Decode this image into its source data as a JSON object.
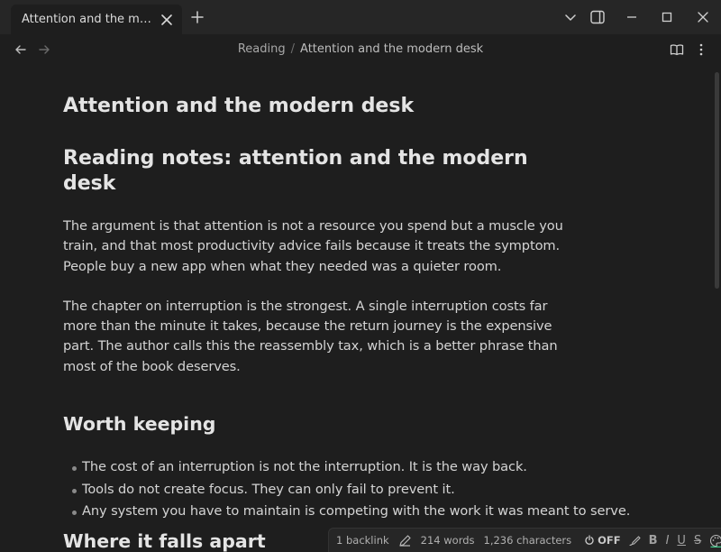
{
  "tab": {
    "title": "Attention and the modern desk"
  },
  "breadcrumb": {
    "folder": "Reading",
    "separator": "/",
    "current": "Attention and the modern desk"
  },
  "note": {
    "title": "Attention and the modern desk",
    "heading": "Reading notes: attention and the modern desk",
    "paragraphs": [
      "The argument is that attention is not a resource you spend but a muscle you train, and that most productivity advice fails because it treats the symptom. People buy a new app when what they needed was a quieter room.",
      "The chapter on interruption is the strongest. A single interruption costs far more than the minute it takes, because the return journey is the expensive part. The author calls this the reassembly tax, which is a better phrase than most of the book deserves."
    ],
    "section1": "Worth keeping",
    "bullets": [
      "The cost of an interruption is not the interruption. It is the way back.",
      "Tools do not create focus. They can only fail to prevent it.",
      "Any system you have to maintain is competing with the work it was meant to serve."
    ],
    "section2": "Where it falls apart"
  },
  "status": {
    "backlinks": "1 backlink",
    "words": "214 words",
    "characters": "1,236 characters",
    "sync": "OFF",
    "format_bold": "B",
    "format_italic": "I",
    "format_underline": "U",
    "format_strike": "S"
  },
  "colors": {
    "background": "#1e1e1e",
    "titlebar": "#262626",
    "text": "#d4d4d4",
    "accent_underline": "#3ecf8e"
  },
  "icons": {
    "tab_close": "close-icon",
    "new_tab": "plus-icon",
    "dropdown": "chevron-down-icon",
    "sidebar": "sidebar-toggle-icon",
    "minimize": "minimize-icon",
    "maximize": "maximize-icon",
    "close": "window-close-icon",
    "back": "arrow-left-icon",
    "forward": "arrow-right-icon",
    "reading": "book-open-icon",
    "more": "more-vertical-icon"
  }
}
